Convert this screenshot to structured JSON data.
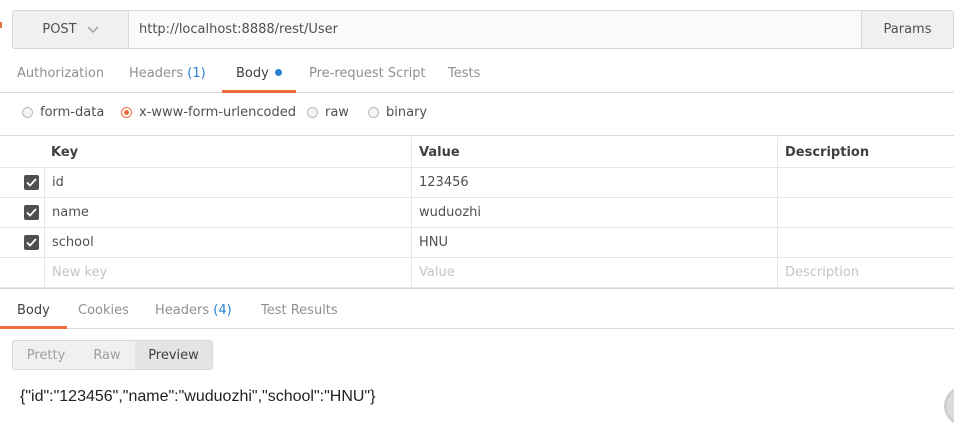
{
  "request": {
    "method": "POST",
    "url": "http://localhost:8888/rest/User",
    "params_label": "Params"
  },
  "request_tabs": [
    {
      "label": "Authorization",
      "count": "",
      "active": false
    },
    {
      "label": "Headers",
      "count": "(1)",
      "active": false
    },
    {
      "label": "Body",
      "count": "",
      "active": true,
      "indicator": "blue-dot"
    },
    {
      "label": "Pre-request Script",
      "count": "",
      "active": false
    },
    {
      "label": "Tests",
      "count": "",
      "active": false
    }
  ],
  "body_types": [
    {
      "label": "form-data",
      "selected": false
    },
    {
      "label": "x-www-form-urlencoded",
      "selected": true
    },
    {
      "label": "raw",
      "selected": false
    },
    {
      "label": "binary",
      "selected": false
    }
  ],
  "kv_table": {
    "headers": {
      "key": "Key",
      "value": "Value",
      "description": "Description"
    },
    "rows": [
      {
        "checked": true,
        "key": "id",
        "value": "123456",
        "description": ""
      },
      {
        "checked": true,
        "key": "name",
        "value": "wuduozhi",
        "description": ""
      },
      {
        "checked": true,
        "key": "school",
        "value": "HNU",
        "description": ""
      }
    ],
    "placeholder": {
      "key": "New key",
      "value": "Value",
      "description": "Description"
    }
  },
  "response_tabs": [
    {
      "label": "Body",
      "count": "",
      "active": true
    },
    {
      "label": "Cookies",
      "count": "",
      "active": false
    },
    {
      "label": "Headers",
      "count": "(4)",
      "active": false
    },
    {
      "label": "Test Results",
      "count": "",
      "active": false
    }
  ],
  "view_modes": [
    {
      "label": "Pretty",
      "active": false
    },
    {
      "label": "Raw",
      "active": false
    },
    {
      "label": "Preview",
      "active": true
    }
  ],
  "response_body": "{\"id\":\"123456\",\"name\":\"wuduozhi\",\"school\":\"HNU\"}",
  "colors": {
    "accent": "#f26b3a",
    "link_blue": "#2a7fd4",
    "checkbox": "#505050"
  }
}
